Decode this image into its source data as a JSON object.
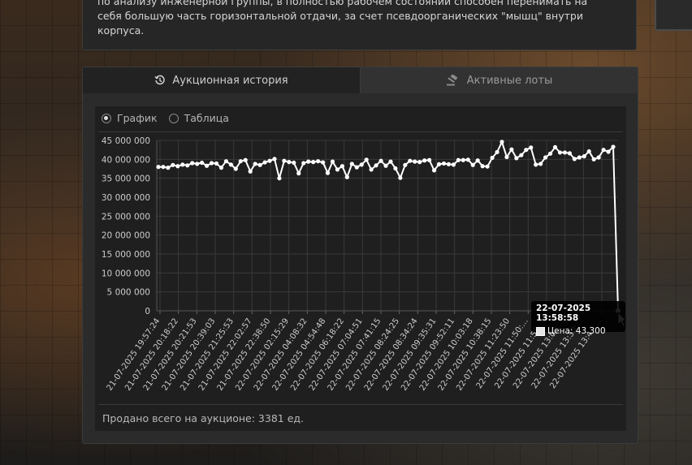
{
  "description": {
    "lines": [
      "по анализу инженерной группы, в полностью рабочем состоянии способен перенимать на",
      "себя большую часть горизонтальной отдачи, за счет псевдоорганических \"мышц\" внутри",
      "корпуса."
    ]
  },
  "tabs": {
    "history": {
      "label": "Аукционная история",
      "icon": "history-icon"
    },
    "active": {
      "label": "Активные лоты",
      "icon": "gavel-icon"
    }
  },
  "view_toggle": {
    "graph": "График",
    "table": "Таблица",
    "selected": "graph"
  },
  "footer": {
    "text": "Продано всего на аукционе: 3381 ед."
  },
  "tooltip": {
    "title": "22-07-2025 13:58:58",
    "label": "Цена: 43 300"
  },
  "colors": {
    "line": "#ffffff",
    "grid": "#3a3a3a",
    "tick_text": "#cccccc"
  },
  "chart_data": {
    "type": "line",
    "ylim": [
      0,
      45000000
    ],
    "yticks": [
      "45 000 000",
      "40 000 000",
      "35 000 000",
      "30 000 000",
      "25 000 000",
      "20 000 000",
      "15 000 000",
      "10 000 000",
      "5 000 000",
      "0"
    ],
    "xticks": [
      "21-07-2025 19:57:24",
      "21-07-2025 20:18:22",
      "21-07-2025 20:21:53",
      "21-07-2025 20:39:03",
      "21-07-2025 21:25:53",
      "21-07-2025 22:02:57",
      "21-07-2025 22:38:50",
      "22-07-2025 02:15:29",
      "22-07-2025 04:08:32",
      "22-07-2025 04:54:48",
      "22-07-2025 06:18:22",
      "22-07-2025 07:04:51",
      "22-07-2025 07:41:15",
      "22-07-2025 08:24:25",
      "22-07-2025 08:34:24",
      "22-07-2025 09:35:31",
      "22-07-2025 09:52:11",
      "22-07-2025 10:03:18",
      "22-07-2025 10:38:15",
      "22-07-2025 11:23:50",
      "22-07-2025 11:50:...",
      "22-07-2025 11:55:...",
      "22-07-2025 13:02:...",
      "22-07-2025 13:30:...",
      "22-07-2025 13:47:..."
    ],
    "values": [
      38000000,
      38000000,
      37800000,
      38500000,
      38200000,
      38600000,
      38400000,
      39000000,
      38800000,
      39100000,
      38300000,
      39000000,
      38900000,
      37800000,
      39500000,
      38600000,
      37500000,
      39500000,
      39800000,
      36800000,
      38800000,
      38500000,
      39200000,
      39600000,
      40100000,
      35000000,
      39600000,
      39300000,
      39100000,
      36300000,
      39000000,
      39400000,
      39300000,
      39500000,
      39200000,
      36400000,
      39400000,
      37300000,
      38200000,
      35300000,
      38800000,
      37900000,
      38600000,
      39900000,
      37300000,
      38400000,
      39600000,
      38300000,
      39400000,
      37600000,
      35100000,
      38500000,
      39600000,
      39400000,
      39300000,
      39700000,
      39800000,
      37100000,
      38700000,
      38900000,
      38700000,
      38600000,
      39800000,
      39800000,
      39900000,
      38500000,
      39700000,
      38200000,
      38100000,
      40400000,
      41900000,
      44600000,
      40600000,
      42600000,
      40300000,
      41100000,
      42500000,
      43100000,
      38600000,
      38800000,
      40500000,
      41500000,
      43200000,
      41800000,
      41800000,
      41600000,
      40100000,
      40500000,
      40800000,
      42100000,
      40000000,
      40500000,
      42500000,
      42000000,
      43300000
    ],
    "last_value": 0,
    "grid": true,
    "legend": "none"
  }
}
